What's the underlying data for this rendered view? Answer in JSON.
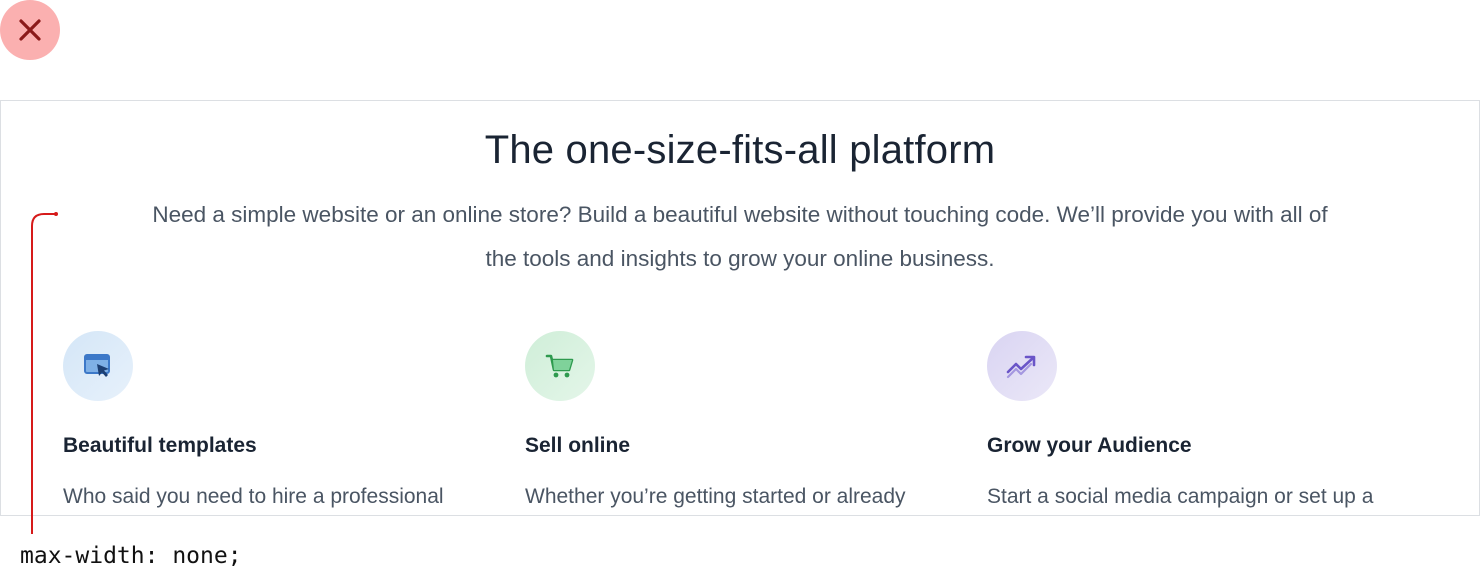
{
  "close": {
    "icon": "close-icon"
  },
  "hero": {
    "title": "The one-size-fits-all platform",
    "intro_line1": "Need a simple website or an online store? Build a beautiful website without touching code. We’ll provide you with all of",
    "intro_line2": "the tools and insights to grow your online business."
  },
  "features": [
    {
      "icon": "browser-cursor-icon",
      "title": "Beautiful templates",
      "text": "Who said you need to hire a professional"
    },
    {
      "icon": "shopping-cart-icon",
      "title": "Sell online",
      "text": "Whether you’re getting started or already"
    },
    {
      "icon": "trending-up-icon",
      "title": "Grow your Audience",
      "text": "Start a social media campaign or set up a"
    }
  ],
  "annotation": {
    "code": "max-width: none;"
  },
  "colors": {
    "close_bg": "#fbb0b0",
    "close_x": "#8b1a1a",
    "callout": "#d61a1a",
    "icon_blue": "#3c78c8",
    "icon_green": "#2e9a4e",
    "icon_purple": "#6a55c8"
  }
}
